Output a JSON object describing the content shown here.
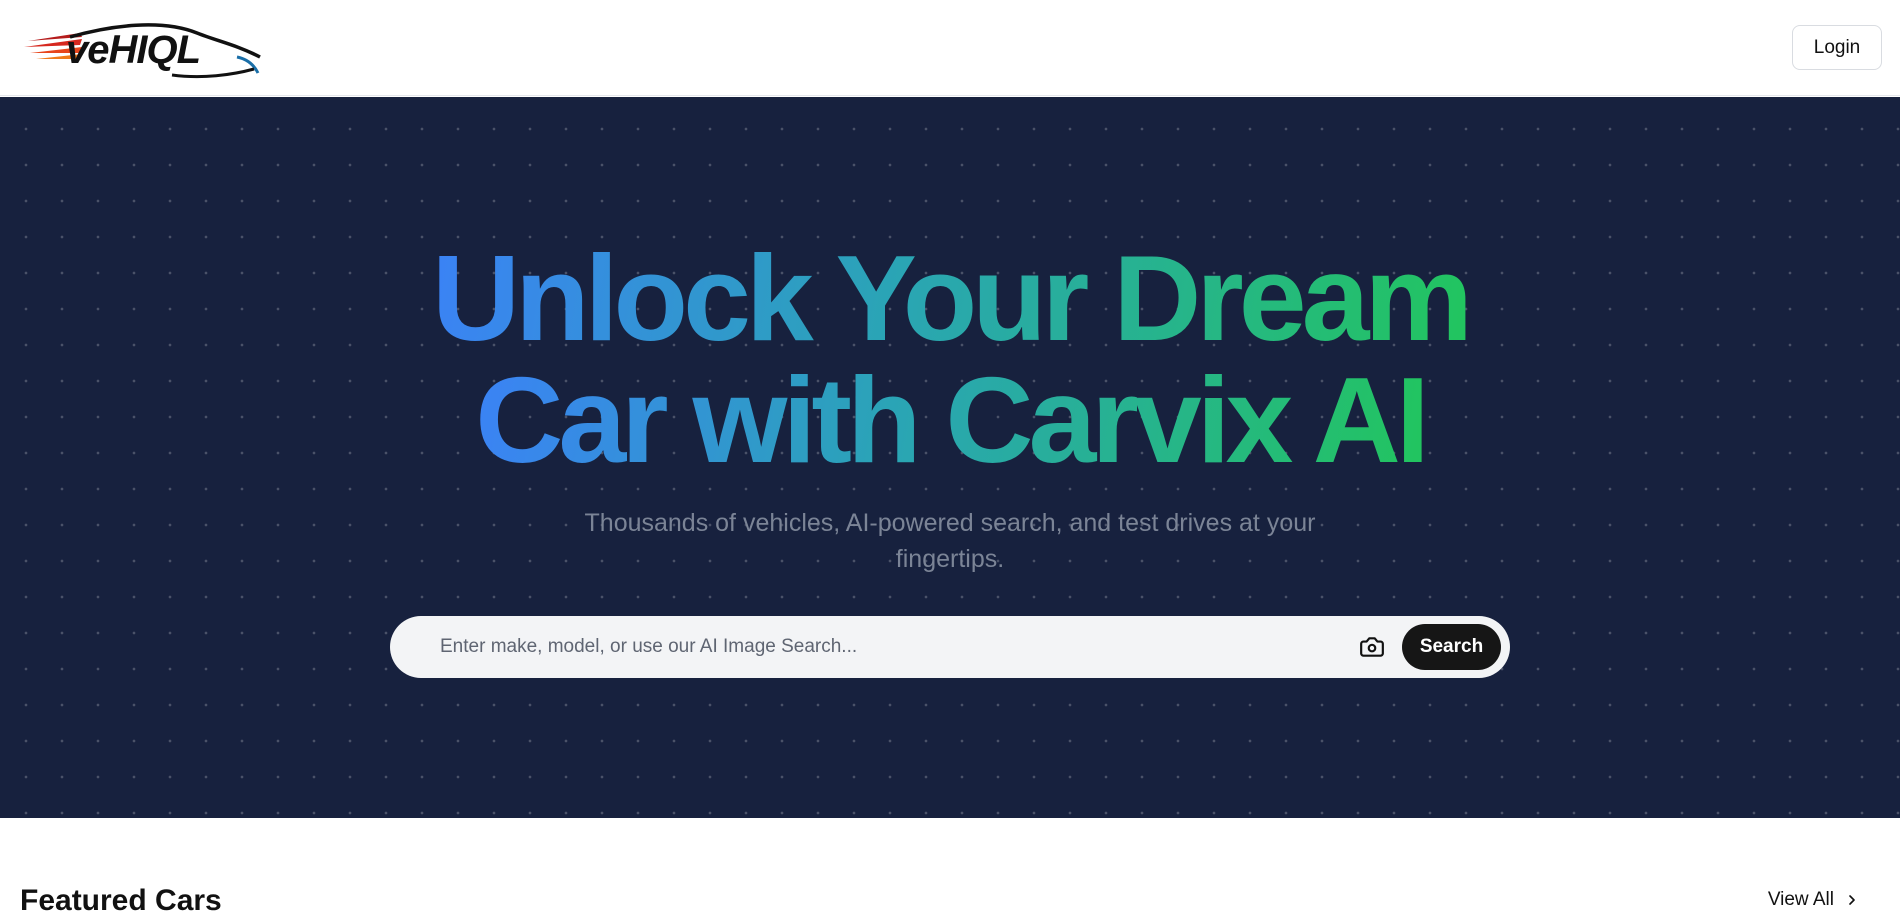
{
  "header": {
    "logo_text": "veHIQL",
    "login_label": "Login"
  },
  "hero": {
    "headline_line1": "Unlock Your Dream",
    "headline_line2": "Car with Carvix AI",
    "subtitle_line1": "Thousands of vehicles, AI-powered search, and test drives at your",
    "subtitle_line2": "fingertips.",
    "search_placeholder": "Enter make, model, or use our AI Image Search...",
    "search_button_label": "Search"
  },
  "featured": {
    "title": "Featured Cars",
    "view_all_label": "View All"
  },
  "colors": {
    "hero_bg": "#17213e",
    "gradient_start": "#3b82f6",
    "gradient_end": "#22c55e"
  },
  "icons": {
    "camera": "camera-icon",
    "chevron": "chevron-right-icon"
  }
}
